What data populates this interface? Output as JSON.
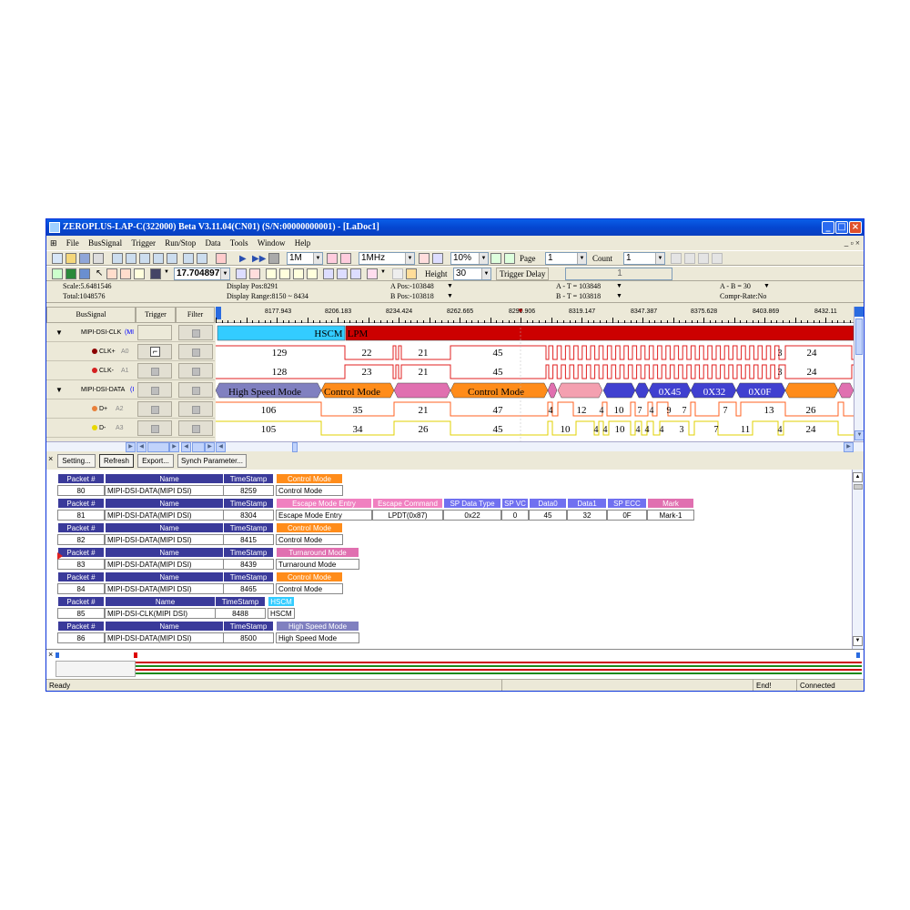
{
  "window": {
    "title": "ZEROPLUS-LAP-C(322000) Beta V3.11.04(CN01) (S/N:00000000001) - [LaDoc1]",
    "min_label": "_",
    "max_label": "□",
    "close_label": "×"
  },
  "menu": {
    "items": [
      "File",
      "BusSignal",
      "Trigger",
      "Run/Stop",
      "Data",
      "Tools",
      "Window",
      "Help"
    ],
    "child_controls": "_ ▫ ×"
  },
  "toolbar1": {
    "sample_depth": "1M",
    "sample_rate": "1MHz",
    "zoom": "10%",
    "page_label": "Page",
    "page_value": "1",
    "count_label": "Count",
    "count_value": "1"
  },
  "toolbar2": {
    "cursor_value": "17.704897",
    "height_label": "Height",
    "height_value": "30",
    "trigger_delay_label": "Trigger Delay",
    "trigger_delay_value": "1"
  },
  "info": {
    "scale": "Scale:5.6481546",
    "total": "Total:1048576",
    "display_pos": "Display Pos:8291",
    "display_range": "Display Range:8150 ~ 8434",
    "a_pos": "A Pos:-103848",
    "b_pos": "B Pos:-103818",
    "a_t": "A - T = 103848",
    "b_t": "B - T = 103818",
    "a_b": "A - B = 30",
    "compr_rate": "Compr-Rate:No"
  },
  "signal_panel": {
    "headers": [
      "BusSignal",
      "Trigger",
      "Filter"
    ],
    "rows": [
      {
        "name": "MIPI-DSI-CLK",
        "suffix": "(MI",
        "pin": ""
      },
      {
        "name": "CLK+",
        "suffix": "",
        "pin": "A0"
      },
      {
        "name": "CLK-",
        "suffix": "",
        "pin": "A1"
      },
      {
        "name": "MIPI-DSI-DATA",
        "suffix": "(I",
        "pin": ""
      },
      {
        "name": "D+",
        "suffix": "",
        "pin": "A2"
      },
      {
        "name": "D-",
        "suffix": "",
        "pin": "A3"
      }
    ],
    "colors": {
      "clk_dot": "#8b0000",
      "clkm_dot": "#d42020",
      "dp_dot": "#e8803a",
      "dm_dot": "#e8d800"
    }
  },
  "ruler": {
    "labels": [
      "8177.943",
      "8206.183",
      "8234.424",
      "8262.665",
      "8290.906",
      "8319.147",
      "8347.387",
      "8375.628",
      "8403.869",
      "8432.11"
    ]
  },
  "waveform": {
    "colors": {
      "hscm": "#33ccff",
      "lpm": "#cc0000",
      "high_speed": "#8080c0",
      "control": "#ff8c1a",
      "turnaround": "#e070b0",
      "escape": "#f4a0b0",
      "data_packet": "#4040d0",
      "clk_trace": "#e02020",
      "dp_trace": "#ff6020",
      "dm_trace": "#e0d000"
    },
    "clk_bus": {
      "hscm": "HSCM",
      "lpm": "LPM"
    },
    "clk_plus_values": [
      "129",
      "22",
      "21",
      "45",
      "3",
      "24"
    ],
    "clk_minus_values": [
      "128",
      "23",
      "21",
      "45",
      "3",
      "24"
    ],
    "data_bus": [
      "High Speed Mode",
      "Control Mode",
      "Control Mode",
      "0X45",
      "0X32",
      "0X0F"
    ],
    "dp_values": [
      "106",
      "35",
      "21",
      "47",
      "4",
      "12",
      "4",
      "10",
      "7",
      "4",
      "9",
      "7",
      "7",
      "13",
      "26"
    ],
    "dm_values": [
      "105",
      "34",
      "26",
      "45",
      "10",
      "4",
      "4",
      "10",
      "4",
      "4",
      "4",
      "3",
      "7",
      "11",
      "4",
      "24"
    ]
  },
  "packet_toolbar": {
    "setting": "Setting...",
    "refresh": "Refresh",
    "export": "Export...",
    "synch": "Synch Parameter..."
  },
  "packets": {
    "header_packet": "Packet #",
    "header_name": "Name",
    "header_timestamp": "TimeStamp",
    "colors": {
      "header_bg": "#3a3a9a",
      "control": "#ff8c1a",
      "escape": "#f080c0",
      "sp": "#7070f0",
      "mark": "#e070b0",
      "turnaround": "#e070b0",
      "hscm": "#33ccff",
      "high_speed": "#8080c0"
    },
    "rows": [
      {
        "num": "80",
        "name": "MIPI-DSI-DATA(MIPI DSI)",
        "ts": "8259",
        "fields": [
          {
            "h": "Control Mode",
            "v": "Control Mode",
            "c": "control"
          }
        ]
      },
      {
        "num": "81",
        "name": "MIPI-DSI-DATA(MIPI DSI)",
        "ts": "8304",
        "fields": [
          {
            "h": "Escape Mode Entry",
            "v": "Escape Mode Entry",
            "c": "escape"
          },
          {
            "h": "Escape Command",
            "v": "LPDT(0x87)",
            "c": "escape"
          },
          {
            "h": "SP Data Type",
            "v": "0x22",
            "c": "sp"
          },
          {
            "h": "SP VC",
            "v": "0",
            "c": "sp"
          },
          {
            "h": "Data0",
            "v": "45",
            "c": "sp"
          },
          {
            "h": "Data1",
            "v": "32",
            "c": "sp"
          },
          {
            "h": "SP ECC",
            "v": "0F",
            "c": "sp"
          },
          {
            "h": "Mark",
            "v": "Mark-1",
            "c": "mark"
          }
        ]
      },
      {
        "num": "82",
        "name": "MIPI-DSI-DATA(MIPI DSI)",
        "ts": "8415",
        "fields": [
          {
            "h": "Control Mode",
            "v": "Control Mode",
            "c": "control"
          }
        ]
      },
      {
        "num": "83",
        "name": "MIPI-DSI-DATA(MIPI DSI)",
        "ts": "8439",
        "fields": [
          {
            "h": "Turnaround Mode",
            "v": "Turnaround Mode",
            "c": "turnaround"
          }
        ]
      },
      {
        "num": "84",
        "name": "MIPI-DSI-DATA(MIPI DSI)",
        "ts": "8465",
        "fields": [
          {
            "h": "Control Mode",
            "v": "Control Mode",
            "c": "control"
          }
        ]
      },
      {
        "num": "85",
        "name": "MIPI-DSI-CLK(MIPI DSI)",
        "ts": "8488",
        "fields": [
          {
            "h": "HSCM",
            "v": "HSCM",
            "c": "hscm"
          }
        ]
      },
      {
        "num": "86",
        "name": "MIPI-DSI-DATA(MIPI DSI)",
        "ts": "8500",
        "fields": [
          {
            "h": "High Speed Mode",
            "v": "High Speed Mode",
            "c": "high_speed"
          }
        ]
      }
    ]
  },
  "status": {
    "ready": "Ready",
    "end": "End!",
    "connected": "Connected"
  }
}
